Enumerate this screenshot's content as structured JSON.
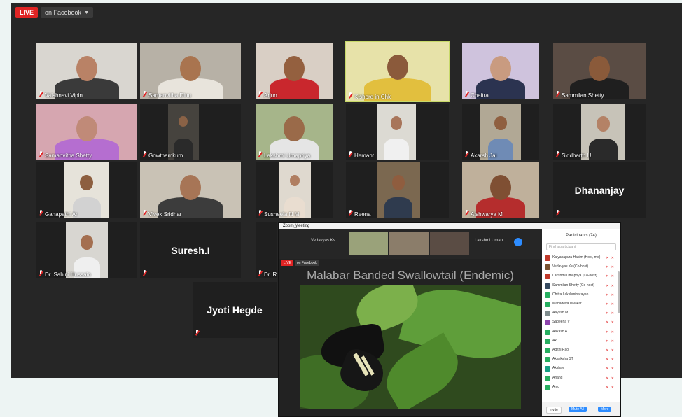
{
  "live": {
    "badge": "LIVE",
    "destination": "on Facebook"
  },
  "tiles": [
    {
      "name": "Vaishnavi Vipin",
      "bg": "#d9d6d0",
      "skin": "#b98266",
      "shirt": "#3a3a3a"
    },
    {
      "name": "Samanvitha Dinu",
      "bg": "#b7b1a6",
      "skin": "#a9744f",
      "shirt": "#e8e4dc"
    },
    {
      "name": "Arjun",
      "bg": "#d9cfc5",
      "skin": "#94603f",
      "shirt": "#c9272d"
    },
    {
      "name": "Kishore in Chk",
      "bg": "#e7e2a9",
      "skin": "#8b5a3b",
      "shirt": "#e2bf3e"
    },
    {
      "name": "Chaitra",
      "bg": "#cfc3dd",
      "skin": "#c99b80",
      "shirt": "#2b3350"
    },
    {
      "name": "Sammilan Shetty",
      "bg": "#5a4c44",
      "skin": "#8a5a3a",
      "shirt": "#1f1f1f"
    },
    {
      "name": "Samanvitha Shetty",
      "bg": "#d6a6b0",
      "skin": "#c08a78",
      "shirt": "#b56ed0"
    },
    {
      "name": "Gowthamkum",
      "bg": "#46433e",
      "skin": "#8a6246",
      "shirt": "#2a2a2a"
    },
    {
      "name": "Lakshmi Umapriya",
      "bg": "#a6b58a",
      "skin": "#9a6a49",
      "shirt": "#e5e5e5"
    },
    {
      "name": "Hemant",
      "bg": "#dcdad3",
      "skin": "#a8755a",
      "shirt": "#f0f0f0"
    },
    {
      "name": "Akarsh Jai",
      "bg": "#b1a895",
      "skin": "#8f5f40",
      "shirt": "#6f8bb5"
    },
    {
      "name": "Siddharth U",
      "bg": "#c7c3b8",
      "skin": "#b48266",
      "shirt": "#2a2a2a"
    },
    {
      "name": "Ganapathi Ar",
      "bg": "#e6e3da",
      "skin": "#8d5f40",
      "shirt": "#d2d2d2"
    },
    {
      "name": "Vivek Sridhar",
      "bg": "#c9c2b5",
      "skin": "#a77556",
      "shirt": "#3c3c3c"
    },
    {
      "name": "Susheela N M",
      "bg": "#dfd9cf",
      "skin": "#b07e61",
      "shirt": "#e9ddd0"
    },
    {
      "name": "Reena",
      "bg": "#7b6850",
      "skin": "#8f5d3f",
      "shirt": "#2f3b4e"
    },
    {
      "name": "Aishwarya M",
      "bg": "#bfb09b",
      "skin": "#7f4f33",
      "shirt": "#b52d2d"
    },
    {
      "name": "",
      "big": "Dhananjay",
      "bg": "#1f1f1f"
    },
    {
      "name": "Dr. Sahini Hussain",
      "bg": "#d8d6d1",
      "skin": "#a46f50",
      "shirt": "#efefef"
    },
    {
      "name": "",
      "big": "Suresh.I",
      "bg": "#1f1f1f"
    },
    {
      "name": "Dr. Rag",
      "bg": "#1f1f1f"
    },
    {
      "name": "",
      "big": "Jyoti Hegde",
      "bg": "#1f1f1f"
    }
  ],
  "share": {
    "window_title": "Zoom Meeting",
    "strip_label_left": "Vedavyas.Ks",
    "strip_label_right": "Lakshmi Umap...",
    "mini_live": "LIVE",
    "mini_fb": "on Facebook",
    "slide_title": "Malabar Banded Swallowtail (Endemic)",
    "panel": {
      "title": "Participants (74)",
      "search_placeholder": "Find a participant",
      "rows": [
        {
          "name": "Kalyanapura Hakim (Host, me)",
          "color": "#c0392b"
        },
        {
          "name": "Vedavyas Ks (Co-host)",
          "color": "#7a5230"
        },
        {
          "name": "Lakshmi Umapriya (Co-host)",
          "color": "#c0392b"
        },
        {
          "name": "Sammilan Shetty (Co-host)",
          "color": "#34495e"
        },
        {
          "name": "Chitra Lakshminarayan",
          "color": "#27ae60"
        },
        {
          "name": "Mahadeva Divakar",
          "color": "#27ae60"
        },
        {
          "name": "Aayush M",
          "color": "#7f8c8d"
        },
        {
          "name": "Sabeena V",
          "color": "#8e44ad"
        },
        {
          "name": "Aakash A",
          "color": "#27ae60"
        },
        {
          "name": "Ak",
          "color": "#27ae60"
        },
        {
          "name": "Adithi Rao",
          "color": "#27ae60"
        },
        {
          "name": "Akanksha ST",
          "color": "#27ae60"
        },
        {
          "name": "Akshay",
          "color": "#16a085"
        },
        {
          "name": "Anand",
          "color": "#27ae60"
        },
        {
          "name": "Anju",
          "color": "#27ae60"
        }
      ],
      "footer_mute_all": "Mute All",
      "footer_more": "More",
      "footer_invite": "Invite"
    }
  }
}
